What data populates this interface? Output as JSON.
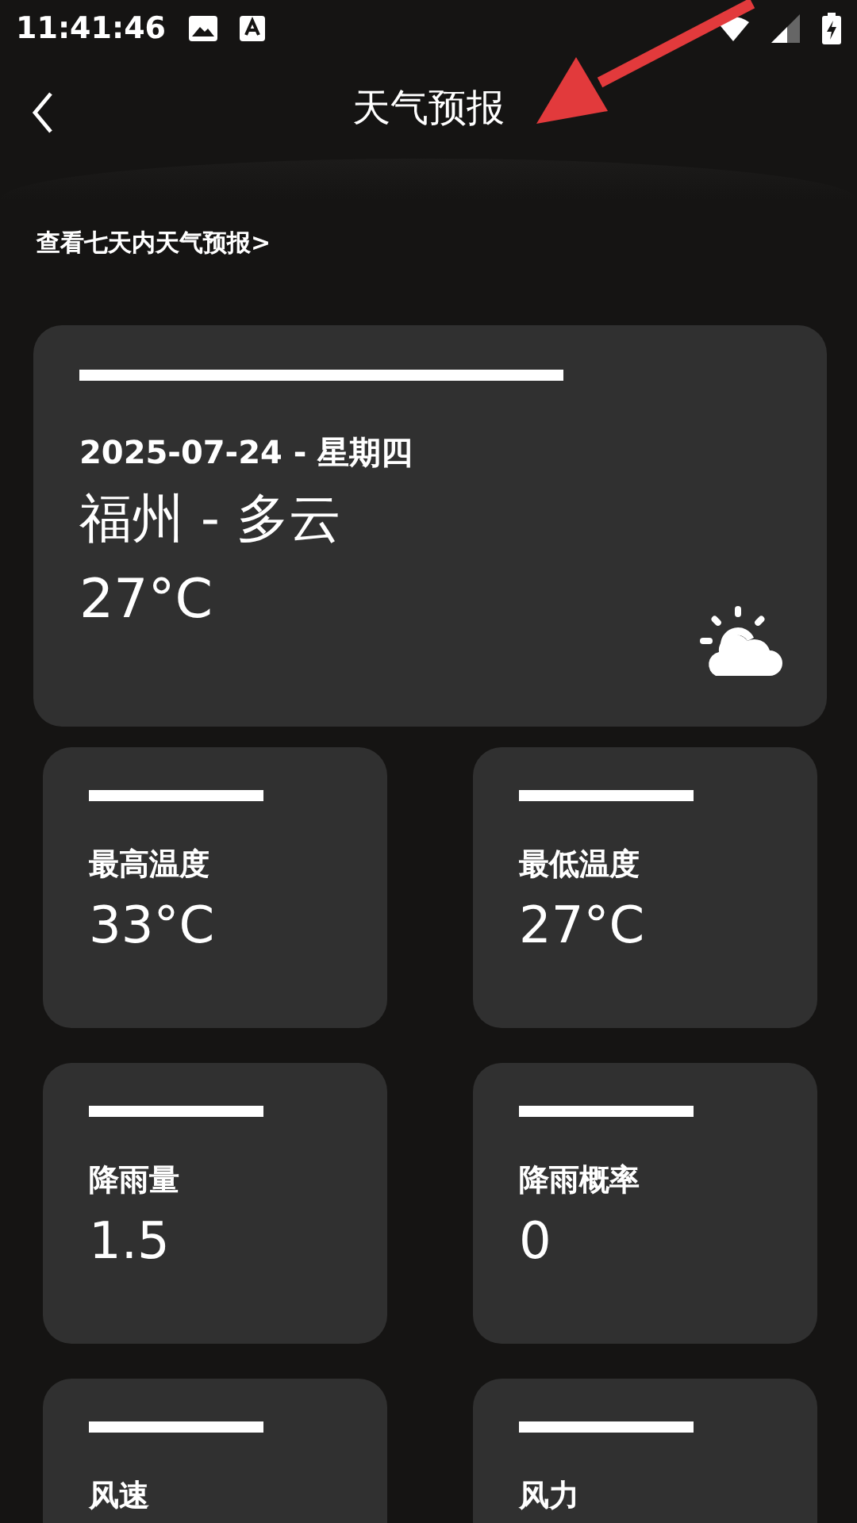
{
  "status_bar": {
    "time": "11:41:46"
  },
  "header": {
    "title": "天气预报"
  },
  "forecast_link": "查看七天内天气预报>",
  "today": {
    "date": "2025-07-24 - 星期四",
    "city_weather": "福州 - 多云",
    "temperature": "27°C"
  },
  "metrics": [
    {
      "label": "最高温度",
      "value": "33°C"
    },
    {
      "label": "最低温度",
      "value": "27°C"
    },
    {
      "label": "降雨量",
      "value": "1.5"
    },
    {
      "label": "降雨概率",
      "value": "0"
    },
    {
      "label": "风速"
    },
    {
      "label": "风力"
    }
  ]
}
